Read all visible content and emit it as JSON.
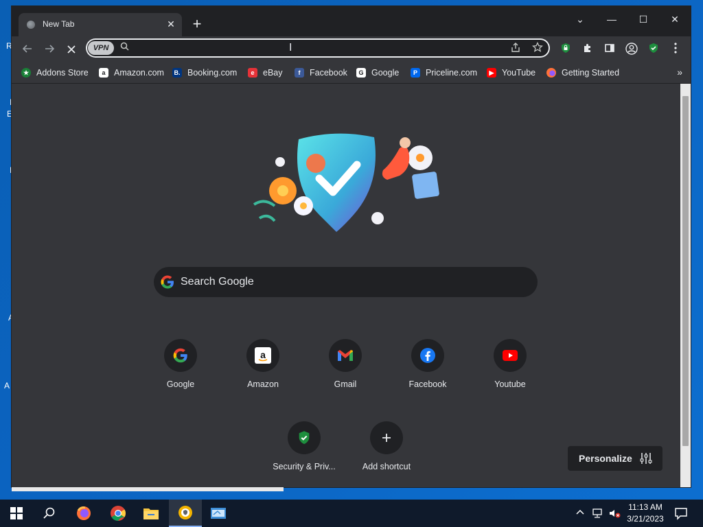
{
  "desktop": {
    "fragments": [
      "R",
      "I",
      "E",
      "I",
      "A",
      "A"
    ]
  },
  "tab": {
    "title": "New Tab",
    "close": "✕"
  },
  "newtab": "+",
  "window_controls": {
    "dropdown": "⌄",
    "minimize": "—",
    "maximize": "☐",
    "close": "✕"
  },
  "omnibox": {
    "vpn_label": "VPN",
    "value": ""
  },
  "bookmarks": [
    {
      "label": "Addons Store",
      "icon": "addons-store-icon",
      "color": "#1a7f37",
      "glyph": "★"
    },
    {
      "label": "Amazon.com",
      "icon": "amazon-icon",
      "color": "#ffffff",
      "glyph": "a"
    },
    {
      "label": "Booking.com",
      "icon": "booking-icon",
      "color": "#003580",
      "glyph": "B."
    },
    {
      "label": "eBay",
      "icon": "ebay-icon",
      "color": "#e53238",
      "glyph": "e"
    },
    {
      "label": "Facebook",
      "icon": "facebook-icon",
      "color": "#3b5998",
      "glyph": "f"
    },
    {
      "label": "Google",
      "icon": "google-icon",
      "color": "#ffffff",
      "glyph": "G"
    },
    {
      "label": "Priceline.com",
      "icon": "priceline-icon",
      "color": "#0068ef",
      "glyph": "P"
    },
    {
      "label": "YouTube",
      "icon": "youtube-icon",
      "color": "#ff0000",
      "glyph": "▶"
    },
    {
      "label": "Getting Started",
      "icon": "firefox-icon",
      "color": "#ff7139",
      "glyph": ""
    }
  ],
  "search": {
    "placeholder": "Search Google"
  },
  "shortcuts": [
    {
      "label": "Google",
      "icon": "google-icon"
    },
    {
      "label": "Amazon",
      "icon": "amazon-icon"
    },
    {
      "label": "Gmail",
      "icon": "gmail-icon"
    },
    {
      "label": "Facebook",
      "icon": "facebook-icon"
    },
    {
      "label": "Youtube",
      "icon": "youtube-icon"
    },
    {
      "label": "Security & Priv...",
      "icon": "shield-check-icon"
    },
    {
      "label": "Add shortcut",
      "icon": "plus-icon"
    }
  ],
  "personalize": {
    "label": "Personalize"
  },
  "taskbar": {
    "clock_time": "11:13 AM",
    "clock_date": "3/21/2023"
  }
}
